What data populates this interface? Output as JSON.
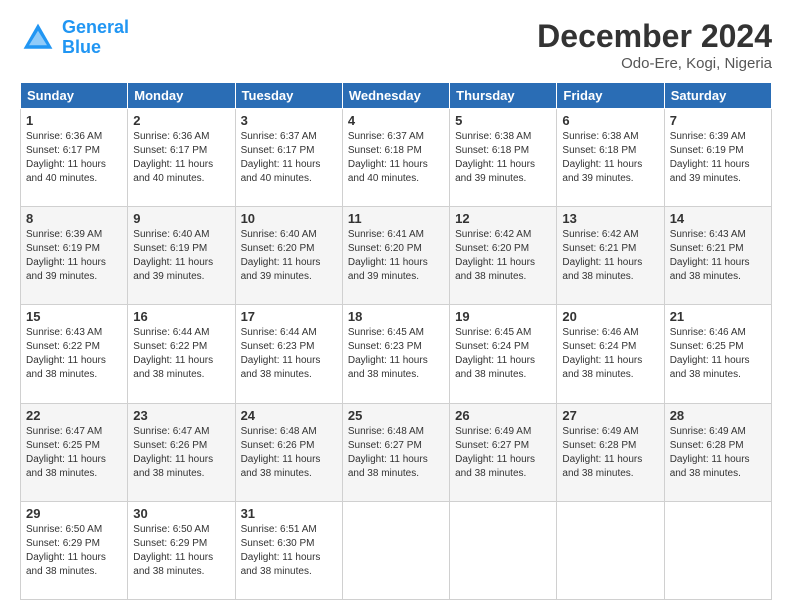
{
  "header": {
    "logo_line1": "General",
    "logo_line2": "Blue",
    "month": "December 2024",
    "location": "Odo-Ere, Kogi, Nigeria"
  },
  "weekdays": [
    "Sunday",
    "Monday",
    "Tuesday",
    "Wednesday",
    "Thursday",
    "Friday",
    "Saturday"
  ],
  "weeks": [
    [
      {
        "day": "1",
        "info": "Sunrise: 6:36 AM\nSunset: 6:17 PM\nDaylight: 11 hours\nand 40 minutes."
      },
      {
        "day": "2",
        "info": "Sunrise: 6:36 AM\nSunset: 6:17 PM\nDaylight: 11 hours\nand 40 minutes."
      },
      {
        "day": "3",
        "info": "Sunrise: 6:37 AM\nSunset: 6:17 PM\nDaylight: 11 hours\nand 40 minutes."
      },
      {
        "day": "4",
        "info": "Sunrise: 6:37 AM\nSunset: 6:18 PM\nDaylight: 11 hours\nand 40 minutes."
      },
      {
        "day": "5",
        "info": "Sunrise: 6:38 AM\nSunset: 6:18 PM\nDaylight: 11 hours\nand 39 minutes."
      },
      {
        "day": "6",
        "info": "Sunrise: 6:38 AM\nSunset: 6:18 PM\nDaylight: 11 hours\nand 39 minutes."
      },
      {
        "day": "7",
        "info": "Sunrise: 6:39 AM\nSunset: 6:19 PM\nDaylight: 11 hours\nand 39 minutes."
      }
    ],
    [
      {
        "day": "8",
        "info": "Sunrise: 6:39 AM\nSunset: 6:19 PM\nDaylight: 11 hours\nand 39 minutes."
      },
      {
        "day": "9",
        "info": "Sunrise: 6:40 AM\nSunset: 6:19 PM\nDaylight: 11 hours\nand 39 minutes."
      },
      {
        "day": "10",
        "info": "Sunrise: 6:40 AM\nSunset: 6:20 PM\nDaylight: 11 hours\nand 39 minutes."
      },
      {
        "day": "11",
        "info": "Sunrise: 6:41 AM\nSunset: 6:20 PM\nDaylight: 11 hours\nand 39 minutes."
      },
      {
        "day": "12",
        "info": "Sunrise: 6:42 AM\nSunset: 6:20 PM\nDaylight: 11 hours\nand 38 minutes."
      },
      {
        "day": "13",
        "info": "Sunrise: 6:42 AM\nSunset: 6:21 PM\nDaylight: 11 hours\nand 38 minutes."
      },
      {
        "day": "14",
        "info": "Sunrise: 6:43 AM\nSunset: 6:21 PM\nDaylight: 11 hours\nand 38 minutes."
      }
    ],
    [
      {
        "day": "15",
        "info": "Sunrise: 6:43 AM\nSunset: 6:22 PM\nDaylight: 11 hours\nand 38 minutes."
      },
      {
        "day": "16",
        "info": "Sunrise: 6:44 AM\nSunset: 6:22 PM\nDaylight: 11 hours\nand 38 minutes."
      },
      {
        "day": "17",
        "info": "Sunrise: 6:44 AM\nSunset: 6:23 PM\nDaylight: 11 hours\nand 38 minutes."
      },
      {
        "day": "18",
        "info": "Sunrise: 6:45 AM\nSunset: 6:23 PM\nDaylight: 11 hours\nand 38 minutes."
      },
      {
        "day": "19",
        "info": "Sunrise: 6:45 AM\nSunset: 6:24 PM\nDaylight: 11 hours\nand 38 minutes."
      },
      {
        "day": "20",
        "info": "Sunrise: 6:46 AM\nSunset: 6:24 PM\nDaylight: 11 hours\nand 38 minutes."
      },
      {
        "day": "21",
        "info": "Sunrise: 6:46 AM\nSunset: 6:25 PM\nDaylight: 11 hours\nand 38 minutes."
      }
    ],
    [
      {
        "day": "22",
        "info": "Sunrise: 6:47 AM\nSunset: 6:25 PM\nDaylight: 11 hours\nand 38 minutes."
      },
      {
        "day": "23",
        "info": "Sunrise: 6:47 AM\nSunset: 6:26 PM\nDaylight: 11 hours\nand 38 minutes."
      },
      {
        "day": "24",
        "info": "Sunrise: 6:48 AM\nSunset: 6:26 PM\nDaylight: 11 hours\nand 38 minutes."
      },
      {
        "day": "25",
        "info": "Sunrise: 6:48 AM\nSunset: 6:27 PM\nDaylight: 11 hours\nand 38 minutes."
      },
      {
        "day": "26",
        "info": "Sunrise: 6:49 AM\nSunset: 6:27 PM\nDaylight: 11 hours\nand 38 minutes."
      },
      {
        "day": "27",
        "info": "Sunrise: 6:49 AM\nSunset: 6:28 PM\nDaylight: 11 hours\nand 38 minutes."
      },
      {
        "day": "28",
        "info": "Sunrise: 6:49 AM\nSunset: 6:28 PM\nDaylight: 11 hours\nand 38 minutes."
      }
    ],
    [
      {
        "day": "29",
        "info": "Sunrise: 6:50 AM\nSunset: 6:29 PM\nDaylight: 11 hours\nand 38 minutes."
      },
      {
        "day": "30",
        "info": "Sunrise: 6:50 AM\nSunset: 6:29 PM\nDaylight: 11 hours\nand 38 minutes."
      },
      {
        "day": "31",
        "info": "Sunrise: 6:51 AM\nSunset: 6:30 PM\nDaylight: 11 hours\nand 38 minutes."
      },
      null,
      null,
      null,
      null
    ]
  ]
}
